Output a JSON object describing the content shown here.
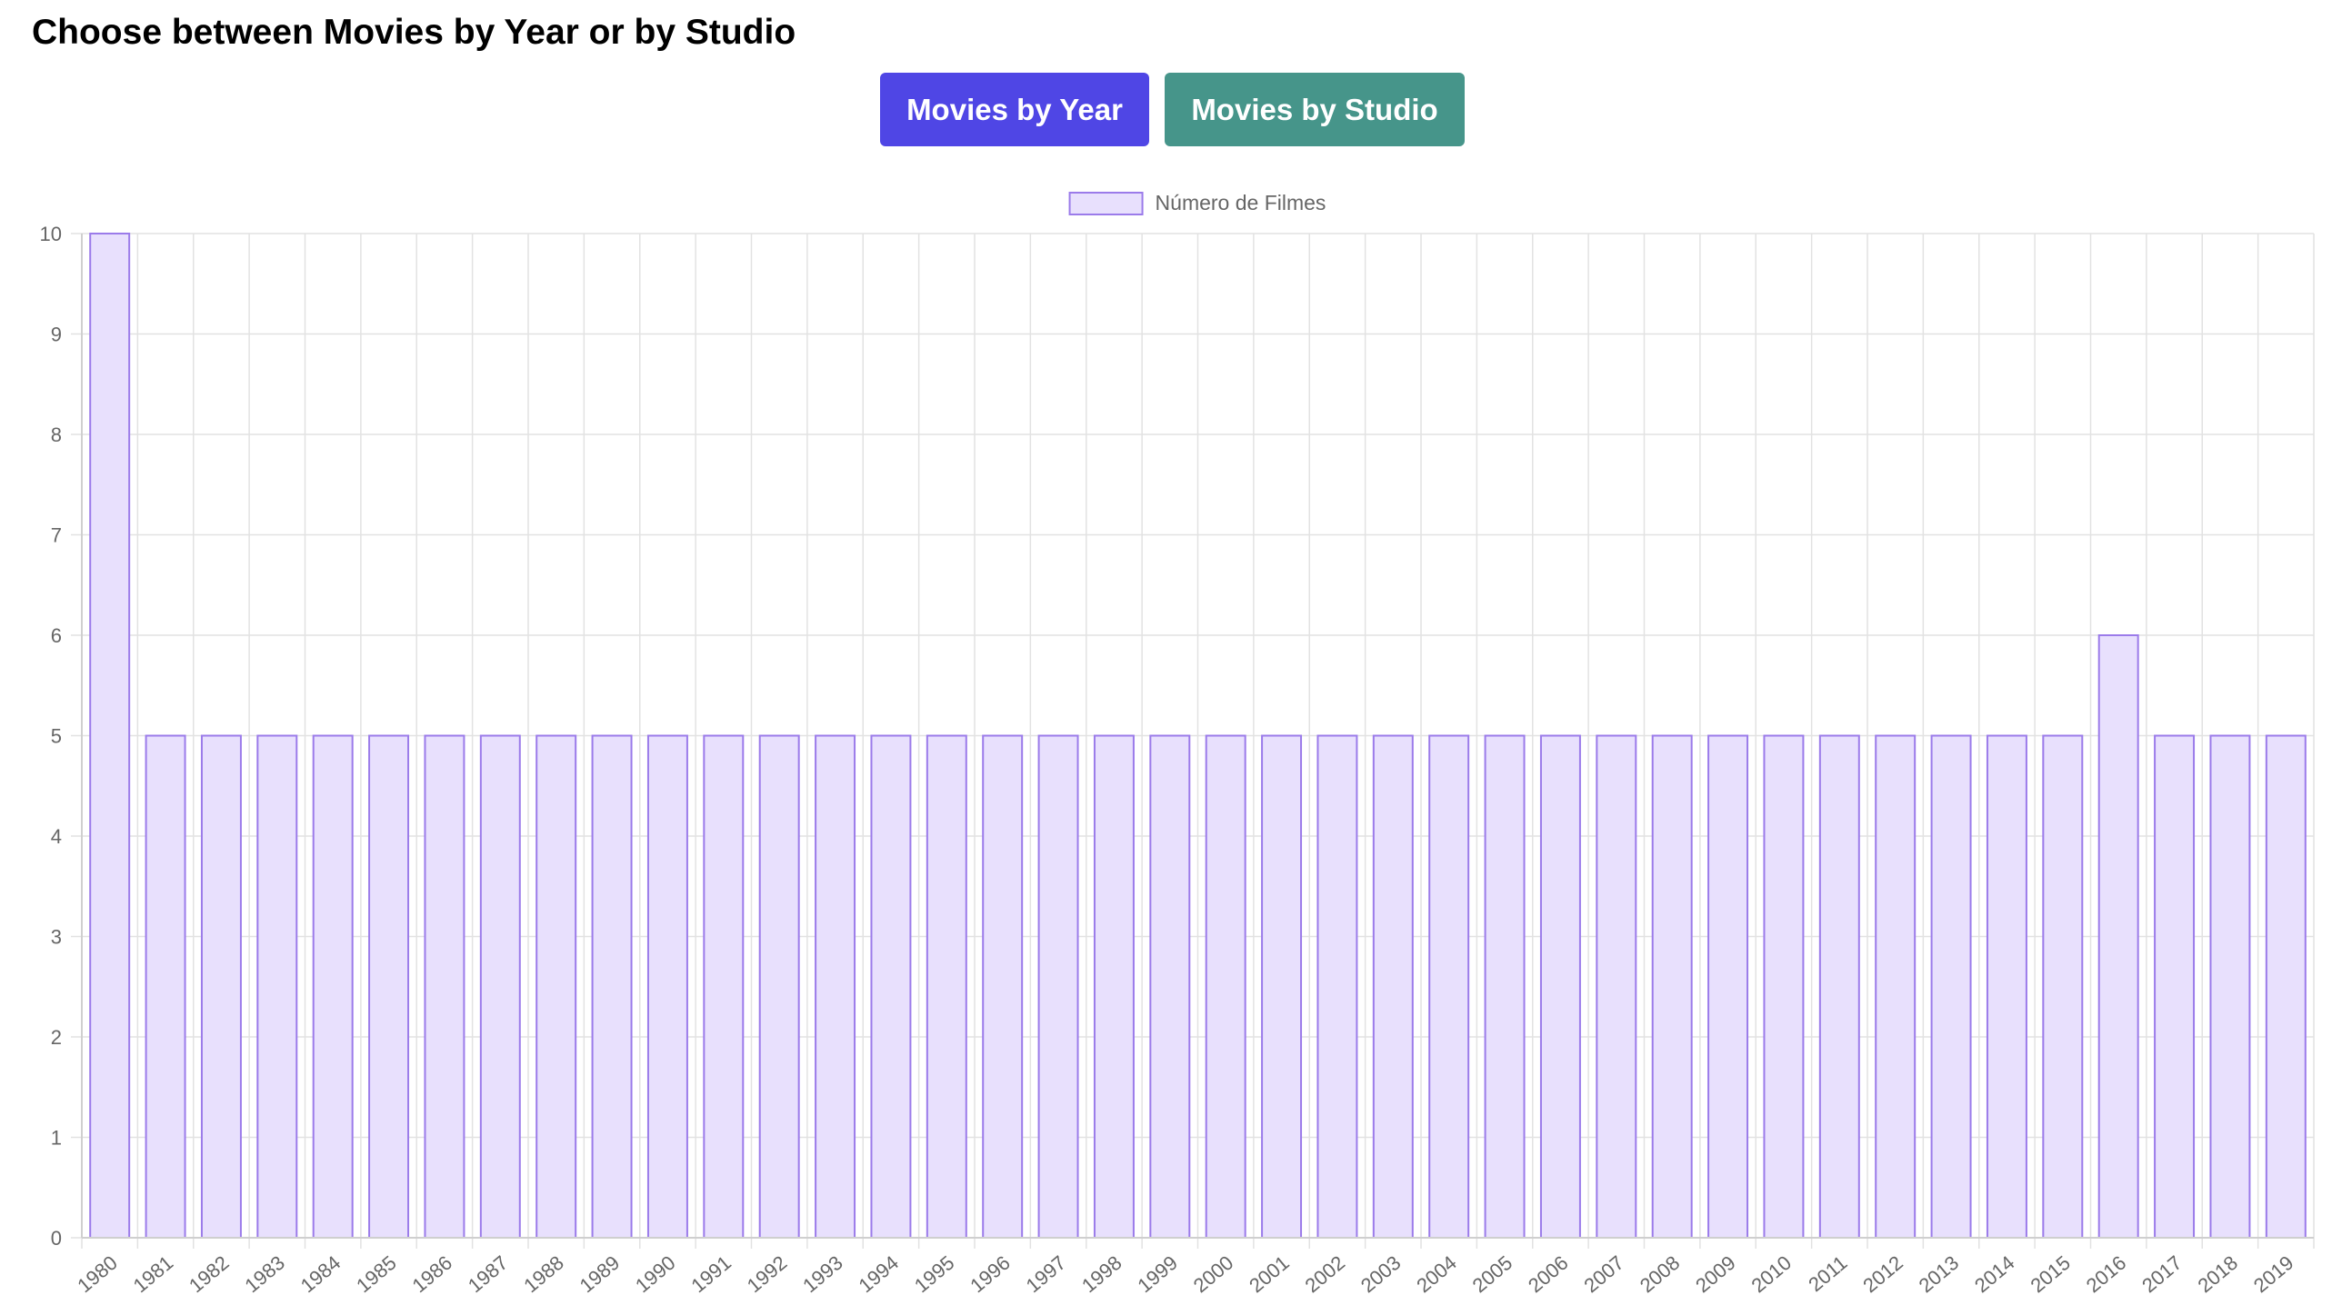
{
  "header": {
    "title": "Choose between Movies by Year or by Studio"
  },
  "buttons": {
    "year_label": "Movies by Year",
    "studio_label": "Movies by Studio"
  },
  "colors": {
    "year_button": "#4f46e5",
    "studio_button": "#46958a",
    "bar_fill": "#e8e0fd",
    "bar_border": "#9b7bea",
    "grid": "#e2e2e2",
    "tick_text": "#666666"
  },
  "chart_data": {
    "type": "bar",
    "legend_position": "top-center",
    "grid": true,
    "series": [
      {
        "name": "Número de Filmes",
        "values": [
          10,
          5,
          5,
          5,
          5,
          5,
          5,
          5,
          5,
          5,
          5,
          5,
          5,
          5,
          5,
          5,
          5,
          5,
          5,
          5,
          5,
          5,
          5,
          5,
          5,
          5,
          5,
          5,
          5,
          5,
          5,
          5,
          5,
          5,
          5,
          5,
          6,
          5,
          5,
          5
        ]
      }
    ],
    "categories": [
      "1980",
      "1981",
      "1982",
      "1983",
      "1984",
      "1985",
      "1986",
      "1987",
      "1988",
      "1989",
      "1990",
      "1991",
      "1992",
      "1993",
      "1994",
      "1995",
      "1996",
      "1997",
      "1998",
      "1999",
      "2000",
      "2001",
      "2002",
      "2003",
      "2004",
      "2005",
      "2006",
      "2007",
      "2008",
      "2009",
      "2010",
      "2011",
      "2012",
      "2013",
      "2014",
      "2015",
      "2016",
      "2017",
      "2018",
      "2019"
    ],
    "yticks": [
      "0",
      "1",
      "2",
      "3",
      "4",
      "5",
      "6",
      "7",
      "8",
      "9",
      "10"
    ],
    "ylim": [
      0,
      10
    ]
  }
}
